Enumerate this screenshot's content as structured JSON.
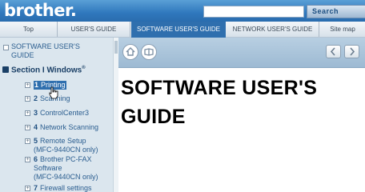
{
  "header": {
    "logo": "brother.",
    "search_placeholder": "",
    "search_button": "Search"
  },
  "tabs": [
    {
      "label": "Top"
    },
    {
      "label": "USER'S GUIDE"
    },
    {
      "label": "SOFTWARE USER'S GUIDE",
      "active": true
    },
    {
      "label": "NETWORK USER'S GUIDE"
    },
    {
      "label": "Site map"
    }
  ],
  "sidebar": {
    "top_link": "SOFTWARE USER'S GUIDE",
    "section": {
      "title": "Section I Windows",
      "mark": "®"
    },
    "items": [
      {
        "num": "1",
        "label": "Printing",
        "active": true
      },
      {
        "num": "2",
        "label": "Scanning"
      },
      {
        "num": "3",
        "label": "ControlCenter3"
      },
      {
        "num": "4",
        "label": "Network Scanning"
      },
      {
        "num": "5",
        "label": "Remote Setup",
        "sub": "(MFC-9440CN only)"
      },
      {
        "num": "6",
        "label": "Brother PC-FAX",
        "sub": "Software",
        "sub2": "(MFC-9440CN only)"
      },
      {
        "num": "7",
        "label": "Firewall settings"
      }
    ]
  },
  "content": {
    "title_line1": "SOFTWARE USER'S",
    "title_line2": "GUIDE"
  },
  "colors": {
    "brand_blue": "#2f78bd",
    "active_tab": "#2f6fae",
    "sidebar_bg": "#dbe6ee"
  },
  "icons": [
    "home-icon",
    "book-icon",
    "back-arrow-icon",
    "forward-arrow-icon",
    "hand-cursor-icon"
  ]
}
